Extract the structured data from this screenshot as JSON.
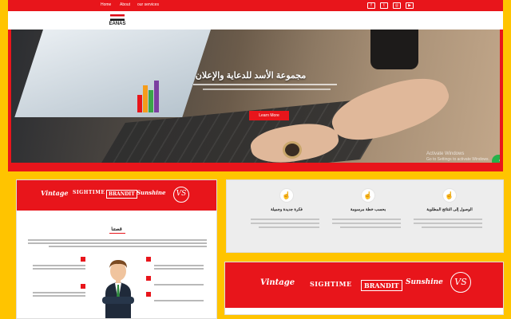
{
  "nav": {
    "links": [
      "Home",
      "About",
      "our services"
    ],
    "social_icons": [
      "facebook-icon",
      "twitter-icon",
      "instagram-icon",
      "youtube-icon"
    ]
  },
  "logo": {
    "text": "EANAS"
  },
  "hero": {
    "title": "مجموعة الأسد للدعاية والإعلان",
    "button_label": "Learn More",
    "activate_line1": "Activate Windows",
    "activate_line2": "Go to Settings to activate Windows."
  },
  "chat": {
    "icon": "chat-bubble-icon"
  },
  "brands": {
    "items": [
      "Vintage",
      "SIGHTIME",
      "BRANDIT",
      "Sunshine"
    ],
    "badge": "VS"
  },
  "about": {
    "title": "قصتنا"
  },
  "features": {
    "columns": [
      {
        "title": "فكرة جديدة وجميلة",
        "icon": "hand-point-icon"
      },
      {
        "title": "بحسب خطة مرسومة",
        "icon": "hand-point-icon"
      },
      {
        "title": "الوصول إلى النتائج المطلوبة",
        "icon": "hand-point-icon"
      }
    ]
  },
  "colors": {
    "brand_red": "#e8151b",
    "page_yellow": "#ffc400"
  }
}
